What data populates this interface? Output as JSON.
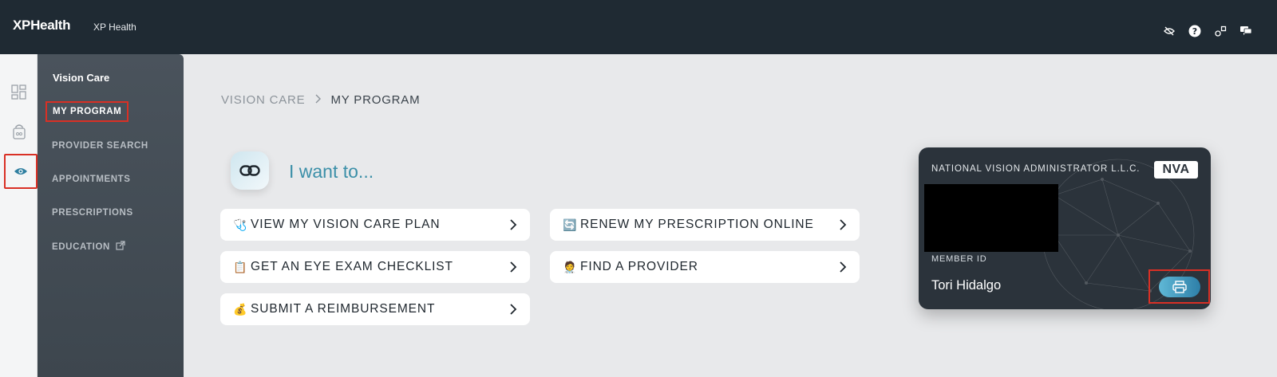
{
  "header": {
    "logo": "XPHealth",
    "app_title": "XP Health",
    "icons": [
      "eye-off-icon",
      "help-icon",
      "shapes-icon",
      "chat-icon"
    ]
  },
  "rail": {
    "icons": [
      "dashboard-icon",
      "bag-icon",
      "eye-icon"
    ],
    "active": "eye-icon"
  },
  "sidebar": {
    "heading": "Vision Care",
    "items": [
      {
        "label": "MY PROGRAM",
        "active": true
      },
      {
        "label": "PROVIDER SEARCH"
      },
      {
        "label": "APPOINTMENTS"
      },
      {
        "label": "PRESCRIPTIONS"
      },
      {
        "label": "EDUCATION",
        "icon": "external-link-icon"
      }
    ]
  },
  "breadcrumb": {
    "parent": "VISION CARE",
    "separator": ">",
    "current": "MY PROGRAM"
  },
  "want": {
    "title": "I want to...",
    "icon": "link-icon"
  },
  "actions": [
    {
      "emoji": "🩺",
      "label": "VIEW MY VISION CARE PLAN"
    },
    {
      "emoji": "🔄",
      "label": "RENEW MY PRESCRIPTION ONLINE"
    },
    {
      "emoji": "📋",
      "label": "GET AN EYE EXAM CHECKLIST"
    },
    {
      "emoji": "🧑‍⚕️",
      "label": "FIND A PROVIDER"
    },
    {
      "emoji": "💰",
      "label": "SUBMIT A REIMBURSEMENT"
    }
  ],
  "card": {
    "issuer": "NATIONAL VISION ADMINISTRATOR L.L.C.",
    "logo_text": "NVA",
    "member_id_label": "MEMBER ID",
    "member_name": "Tori Hidalgo",
    "print_icon": "printer-icon"
  },
  "colors": {
    "topbar": "#1f2a33",
    "sidebar": "#4a535c",
    "accent": "#3b8fa8",
    "highlight": "#d93025",
    "card": "#2b333b"
  }
}
